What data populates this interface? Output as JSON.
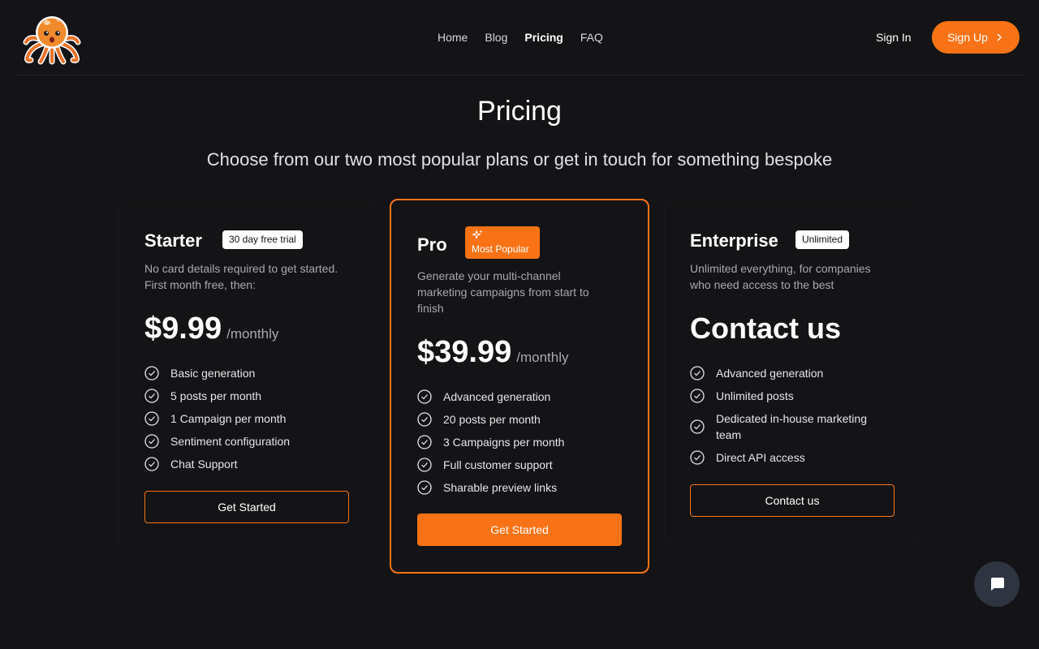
{
  "nav": {
    "links": [
      "Home",
      "Blog",
      "Pricing",
      "FAQ"
    ],
    "active": "Pricing",
    "sign_in": "Sign In",
    "sign_up": "Sign Up"
  },
  "hero": {
    "title": "Pricing",
    "subtitle": "Choose from our two most popular plans or get in touch for something bespoke"
  },
  "plans": [
    {
      "name": "Starter",
      "badge": "30 day free trial",
      "description": "No card details required to get started. First month free, then:",
      "price": "$9.99",
      "period": "/monthly",
      "features": [
        "Basic generation",
        "5 posts per month",
        "1 Campaign per month",
        "Sentiment configuration",
        "Chat Support"
      ],
      "cta": "Get Started"
    },
    {
      "name": "Pro",
      "badge": "Most Popular",
      "description": "Generate your multi-channel marketing campaigns from start to finish",
      "price": "$39.99",
      "period": "/monthly",
      "features": [
        "Advanced generation",
        "20 posts per month",
        "3 Campaigns per month",
        "Full customer support",
        "Sharable preview links"
      ],
      "cta": "Get Started"
    },
    {
      "name": "Enterprise",
      "badge": "Unlimited",
      "description": "Unlimited everything, for companies who need access to the best",
      "price": "Contact us",
      "features": [
        "Advanced generation",
        "Unlimited posts",
        "Dedicated in-house marketing team",
        "Direct API access"
      ],
      "cta": "Contact us"
    }
  ],
  "colors": {
    "accent": "#f97316",
    "background": "#141416"
  },
  "icons": {
    "logo": "octopus-logo-icon",
    "check": "check-circle-icon",
    "chat": "chat-bubble-icon",
    "sparkle": "sparkle-icon",
    "chevron": "chevron-right-icon"
  }
}
